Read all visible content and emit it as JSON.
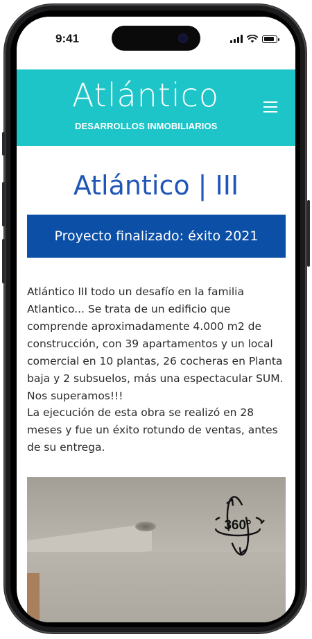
{
  "status_bar": {
    "time": "9:41",
    "battery_level": 0.9
  },
  "header": {
    "brand_name": "Atlántico",
    "brand_subtitle": "DESARROLLOS INMOBILIARIOS",
    "menu_icon": "hamburger-menu-icon",
    "background_color": "#1ec5c8"
  },
  "main": {
    "title": "Atlántico | III",
    "status_banner": "Proyecto finalizado: éxito 2021",
    "paragraphs": [
      "Atlántico III todo un desafío en la familia Atlantico... Se trata de un edificio que comprende aproximadamente 4.000 m2 de construcción, con 39 apartamentos y un local comercial en 10 plantas, 26 cocheras en Planta baja y 2 subsuelos, más una espectacular SUM. Nos superamos!!!",
      "La ejecución de esta obra se realizó en 28 meses y fue un éxito rotundo de ventas, antes de su entrega."
    ],
    "panorama": {
      "badge_text": "360°",
      "icon": "360-view-icon"
    },
    "accent_color": "#0b4fa7"
  }
}
